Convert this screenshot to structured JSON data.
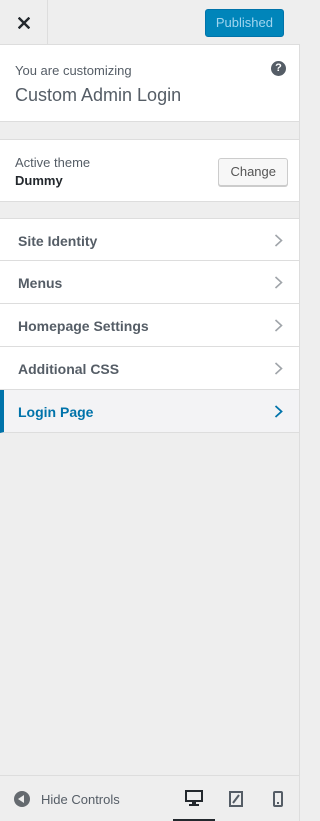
{
  "header": {
    "close_icon": "close-icon",
    "publish_label": "Published"
  },
  "info": {
    "kicker": "You are customizing",
    "site_title": "Custom Admin Login",
    "help_glyph": "?",
    "help_icon": "help-icon"
  },
  "theme": {
    "label": "Active theme",
    "name": "Dummy",
    "change_label": "Change"
  },
  "sections": {
    "items": [
      {
        "label": "Site Identity"
      },
      {
        "label": "Menus"
      },
      {
        "label": "Homepage Settings"
      },
      {
        "label": "Additional CSS"
      },
      {
        "label": "Login Page",
        "active": true
      }
    ]
  },
  "footer": {
    "hide_controls_label": "Hide Controls",
    "devices": [
      {
        "icon": "desktop-icon",
        "active": true
      },
      {
        "icon": "tablet-icon",
        "active": false
      },
      {
        "icon": "mobile-icon",
        "active": false
      }
    ]
  },
  "colors": {
    "accent": "#0073aa",
    "publish_bg": "#0085ba",
    "panel_bg": "#eeeeee"
  }
}
